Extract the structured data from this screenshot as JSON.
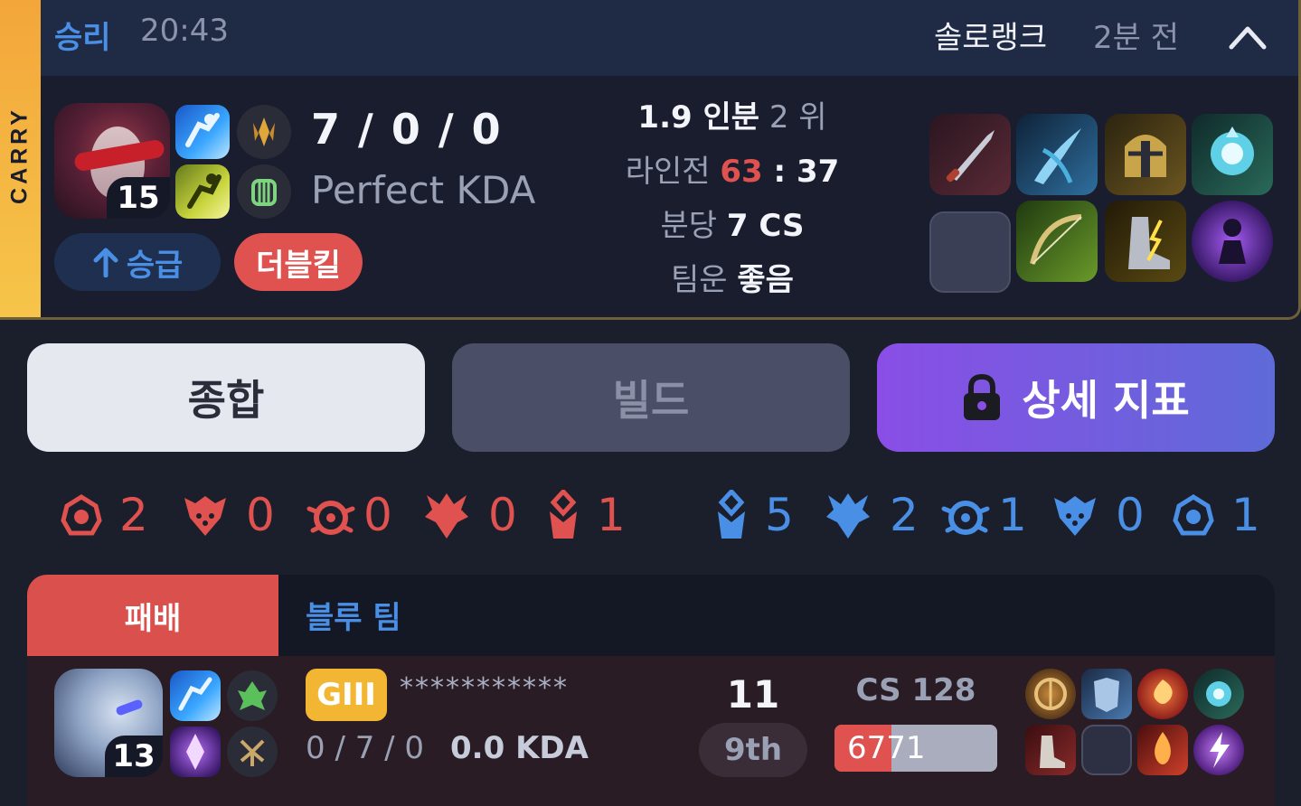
{
  "badge": {
    "carry": "CARRY"
  },
  "header": {
    "result": "승리",
    "duration": "20:43",
    "queue": "솔로랭크",
    "time_ago": "2분 전"
  },
  "champion": {
    "level": "15"
  },
  "kda": {
    "score": "7 / 0 / 0",
    "label": "Perfect KDA"
  },
  "tags": {
    "promotion": "승급",
    "multikill": "더블킬"
  },
  "stats": {
    "share_value": "1.9 인분",
    "share_rank": "2 위",
    "lane_label": "라인전",
    "lane_us": "63",
    "lane_sep": " : ",
    "lane_them": "37",
    "cs_label": "분당",
    "cs_value": "7 CS",
    "teamluck_label": "팀운",
    "teamluck_value": "좋음"
  },
  "tabs": {
    "summary": "종합",
    "build": "빌드",
    "detail": "상세 지표"
  },
  "objectives": {
    "red": [
      {
        "icon": "baron-icon",
        "count": "2"
      },
      {
        "icon": "herald-icon",
        "count": "0"
      },
      {
        "icon": "grubs-icon",
        "count": "0"
      },
      {
        "icon": "dragon-icon",
        "count": "0"
      },
      {
        "icon": "tower-icon",
        "count": "1"
      }
    ],
    "blue": [
      {
        "icon": "tower-icon",
        "count": "5"
      },
      {
        "icon": "dragon-icon",
        "count": "2"
      },
      {
        "icon": "grubs-icon",
        "count": "1"
      },
      {
        "icon": "herald-icon",
        "count": "0"
      },
      {
        "icon": "baron-icon",
        "count": "1"
      }
    ]
  },
  "team": {
    "result": "패배",
    "name": "블루 팀"
  },
  "player": {
    "level": "13",
    "tier": "GIII",
    "name": "***********",
    "kda": "0 / 7 / 0",
    "kda_ratio": "0.0 KDA",
    "score": "11",
    "rank": "9th",
    "cs": "CS 128",
    "damage": "6771",
    "damage_fraction": 0.35
  },
  "colors": {
    "win": "#4a8fe6",
    "loss": "#e0524f",
    "carry": "#f6c54a",
    "tier_gold": "#f2b632",
    "accent_purple": "#8a4ee6"
  }
}
